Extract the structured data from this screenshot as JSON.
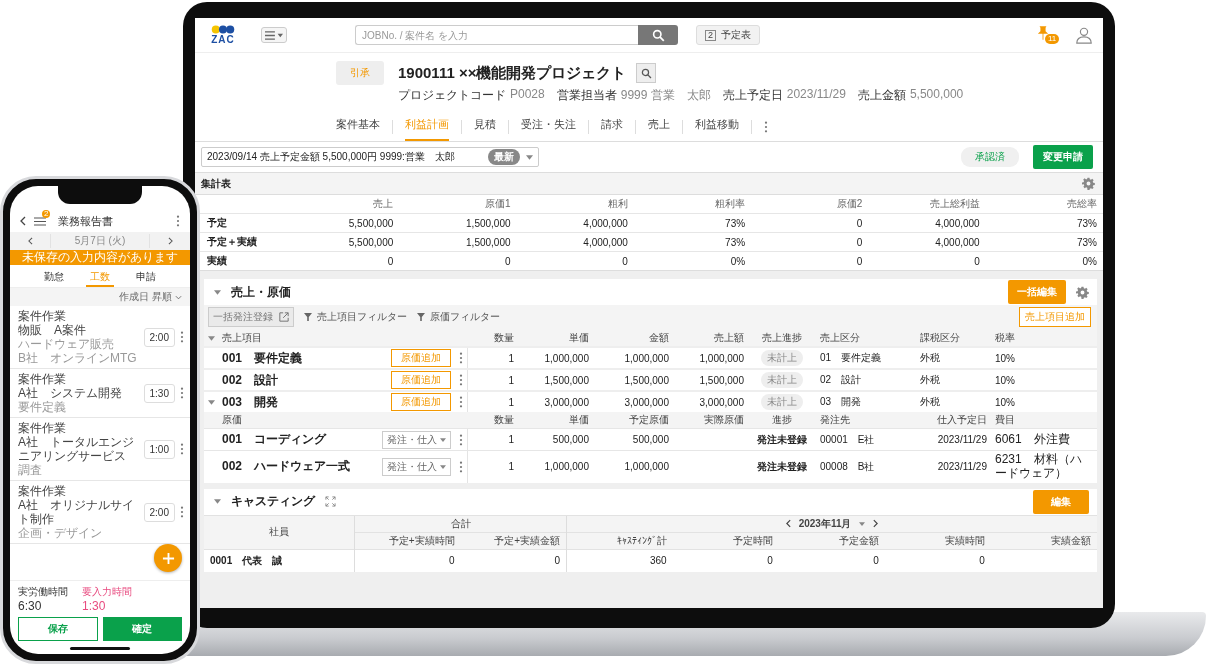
{
  "app": {
    "logo": "ZAC",
    "search_placeholder": "JOBNo. / 案件名 を入力",
    "schedule_day": "2",
    "schedule_label": "予定表",
    "notification_count": "11"
  },
  "project": {
    "status": "引承",
    "title": "1900111 ××機能開発プロジェクト",
    "meta": [
      {
        "label": "プロジェクトコード",
        "value": "P0028"
      },
      {
        "label": "営業担当者",
        "value": "9999 営業　太郎"
      },
      {
        "label": "売上予定日",
        "value": "2023/11/29"
      },
      {
        "label": "売上金額",
        "value": "5,500,000"
      }
    ]
  },
  "tabs": [
    {
      "label": "案件基本",
      "selected": false
    },
    {
      "label": "利益計画",
      "selected": true
    },
    {
      "label": "見積",
      "selected": false
    },
    {
      "label": "受注・失注",
      "selected": false
    },
    {
      "label": "請求",
      "selected": false
    },
    {
      "label": "売上",
      "selected": false
    },
    {
      "label": "利益移動",
      "selected": false
    }
  ],
  "revision": {
    "value": "2023/09/14 売上予定金額 5,500,000円 9999:営業　太郎",
    "badge": "最新",
    "approval": "承認済",
    "request_button": "変更申請"
  },
  "summary": {
    "title": "集計表",
    "columns": [
      "売上",
      "原価1",
      "粗利",
      "粗利率",
      "原価2",
      "売上総利益",
      "売総率"
    ],
    "rows": [
      {
        "label": "予定",
        "values": [
          "5,500,000",
          "1,500,000",
          "4,000,000",
          "73%",
          "0",
          "4,000,000",
          "73%"
        ]
      },
      {
        "label": "予定＋実績",
        "values": [
          "5,500,000",
          "1,500,000",
          "4,000,000",
          "73%",
          "0",
          "4,000,000",
          "73%"
        ]
      },
      {
        "label": "実績",
        "values": [
          "0",
          "0",
          "0",
          "0%",
          "0",
          "0",
          "0%"
        ]
      }
    ]
  },
  "sales": {
    "title": "売上・原価",
    "bulk_edit": "一括編集",
    "bulk_order": "一括発注登録",
    "filters": [
      "売上項目フィルター",
      "原価フィルター"
    ],
    "add_item": "売上項目追加",
    "columns": [
      "売上項目",
      "数量",
      "単価",
      "金額",
      "売上額",
      "売上進捗",
      "売上区分",
      "課税区分",
      "税率"
    ],
    "cost_columns": [
      "原価",
      "数量",
      "単価",
      "予定原価",
      "実際原価",
      "進捗",
      "発注先",
      "仕入予定日",
      "費目"
    ],
    "items": [
      {
        "name": "001　要件定義",
        "action": "原価追加",
        "values": [
          "1",
          "1,000,000",
          "1,000,000",
          "1,000,000"
        ],
        "progress": "未計上",
        "category": "01　要件定義",
        "tax_type": "外税",
        "tax_rate": "10%",
        "expanded": false
      },
      {
        "name": "002　設計",
        "action": "原価追加",
        "values": [
          "1",
          "1,500,000",
          "1,500,000",
          "1,500,000"
        ],
        "progress": "未計上",
        "category": "02　設計",
        "tax_type": "外税",
        "tax_rate": "10%",
        "expanded": false
      },
      {
        "name": "003　開発",
        "action": "原価追加",
        "values": [
          "1",
          "3,000,000",
          "3,000,000",
          "3,000,000"
        ],
        "progress": "未計上",
        "category": "03　開発",
        "tax_type": "外税",
        "tax_rate": "10%",
        "expanded": true,
        "costs": [
          {
            "name": "001　コーディング",
            "action": "発注・仕入",
            "values": [
              "1",
              "500,000",
              "500,000"
            ],
            "status": "発注未登録",
            "vendor": "00001　E社",
            "date": "2023/11/29",
            "expense": "6061　外注費"
          },
          {
            "name": "002　ハードウェア一式",
            "action": "発注・仕入",
            "values": [
              "1",
              "1,000,000",
              "1,000,000"
            ],
            "status": "発注未登録",
            "vendor": "00008　B社",
            "date": "2023/11/29",
            "expense": "6231　材料（ハードウェア）"
          }
        ]
      }
    ]
  },
  "casting": {
    "title": "キャスティング",
    "edit": "編集",
    "employee_header": "社員",
    "total_header": "合計",
    "month": "2023年11月",
    "total_columns": [
      "予定+実績時間",
      "予定+実績金額"
    ],
    "month_columns": [
      "ｷｬｽﾃｨﾝｸﾞ計",
      "予定時間",
      "予定金額",
      "実績時間",
      "実績金額"
    ],
    "rows": [
      {
        "name": "0001　代表　誠",
        "values": [
          "0",
          "0",
          "360",
          "0",
          "0",
          "0"
        ]
      }
    ]
  },
  "mobile": {
    "title": "業務報告書",
    "menu_badge": "2",
    "date": "5月7日 (火)",
    "banner": "未保存の入力内容があります",
    "tabs": [
      {
        "label": "勤怠",
        "selected": false
      },
      {
        "label": "工数",
        "selected": true
      },
      {
        "label": "申請",
        "selected": false
      }
    ],
    "sort": "作成日 昇順",
    "entries": [
      {
        "lines": [
          "案件作業",
          "物販　A案件"
        ],
        "notes": [
          "ハードウェア販売",
          "B社　オンラインMTG"
        ],
        "time": "2:00"
      },
      {
        "lines": [
          "案件作業",
          "A社　システム開発"
        ],
        "notes": [
          "要件定義"
        ],
        "time": "1:30"
      },
      {
        "lines": [
          "案件作業",
          "A社　トータルエンジニアリングサービス"
        ],
        "notes": [
          "調査"
        ],
        "time": "1:00"
      },
      {
        "lines": [
          "案件作業",
          "A社　オリジナルサイト制作"
        ],
        "notes": [
          "企画・デザイン"
        ],
        "time": "2:00"
      }
    ],
    "worked_label": "実労働時間",
    "worked": "6:30",
    "missing_label": "要入力時間",
    "missing": "1:30",
    "save": "保存",
    "confirm": "確定"
  }
}
